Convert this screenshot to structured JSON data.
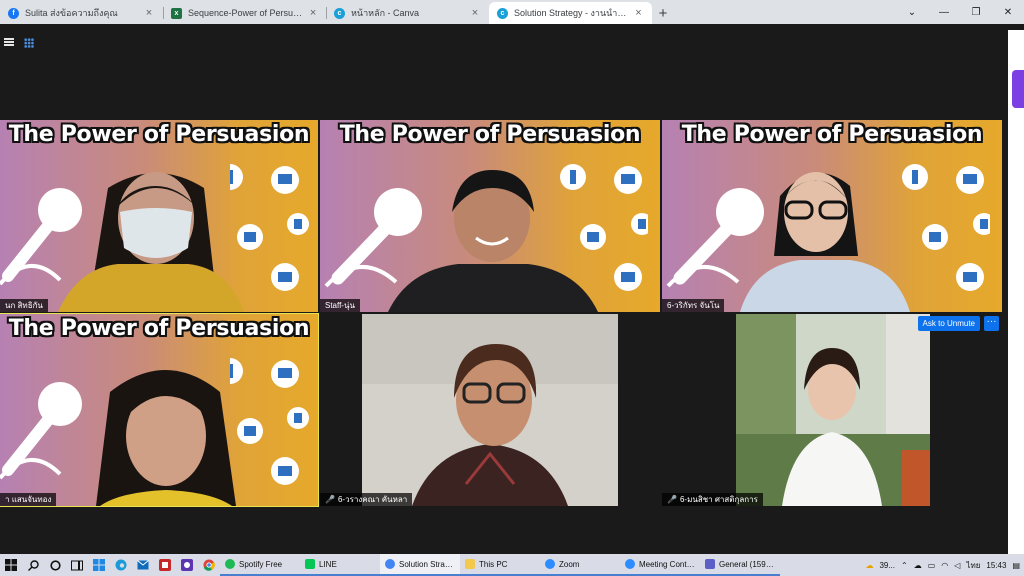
{
  "browser": {
    "tabs": [
      {
        "title": "Sulita ส่งข้อความถึงคุณ",
        "icon": "facebook-icon"
      },
      {
        "title": "Sequence-Power of Persuation.xlsx",
        "icon": "excel-icon"
      },
      {
        "title": "หน้าหลัก - Canva",
        "icon": "canva-icon"
      },
      {
        "title": "Solution Strategy - งานนำเสนอ",
        "icon": "canva-icon"
      }
    ],
    "close_glyph": "×",
    "newtab_glyph": "+"
  },
  "meeting": {
    "banner_title": "The Power of Persuasion",
    "participants": [
      {
        "name": "นก สิทธิกัน",
        "muted": false
      },
      {
        "name": "Staff-นุ่น",
        "muted": false
      },
      {
        "name": "6-วริกัทร จันโน",
        "muted": false
      },
      {
        "name": "า แสนจันทอง",
        "muted": false
      },
      {
        "name": "6-วรางคณา คันหลา",
        "muted": true
      },
      {
        "name": "6-มนสิชา ศาสติกุลการ",
        "muted": true
      }
    ],
    "ask_to_unmute": "Ask to Unmute",
    "more_glyph": "···"
  },
  "taskbar": {
    "apps": [
      {
        "label": "Spotify Free",
        "color": "#1db954"
      },
      {
        "label": "LINE",
        "color": "#06c755"
      },
      {
        "label": "Solution Strate...",
        "color": "#4285f4"
      },
      {
        "label": "This PC",
        "color": "#f2c94c"
      },
      {
        "label": "Zoom",
        "color": "#2d8cff"
      },
      {
        "label": "Meeting Contr...",
        "color": "#2d8cff"
      },
      {
        "label": "General (15943...",
        "color": "#5b5fc7"
      }
    ],
    "weather": "39...",
    "language": "ไทย",
    "time": "15:43"
  },
  "colors": {
    "zoom_blue": "#0e72ed",
    "speaker_outline": "#e8e34f",
    "mute_red": "#e0403a"
  }
}
